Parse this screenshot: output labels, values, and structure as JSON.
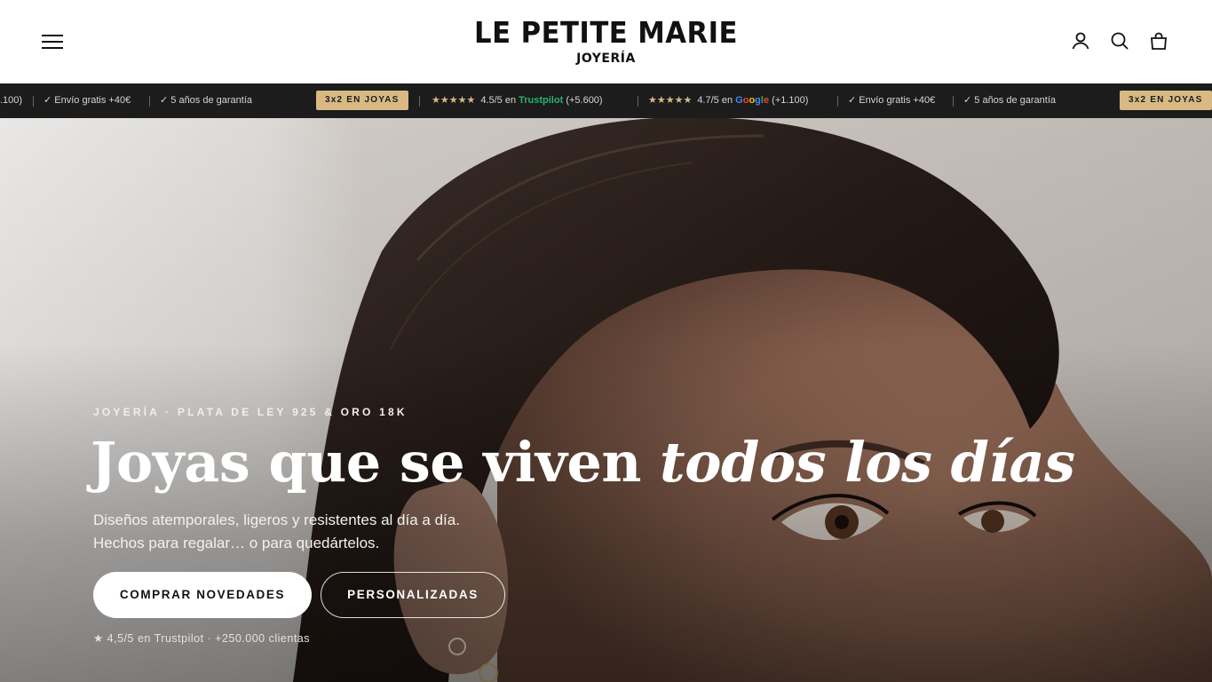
{
  "header": {
    "brand": "LE PETITE MARIE",
    "brand_sub": "JOYERÍA",
    "icons": [
      "menu-icon",
      "account-icon",
      "search-icon",
      "bag-icon"
    ]
  },
  "announcement": {
    "partial_left": ".100)",
    "shipping": "✓ Envío gratis +40€",
    "warranty": "✓ 5 años de garantía",
    "promo": "3x2 EN JOYAS",
    "stars": "★★★★★",
    "trustpilot_score": "4.5/5 en",
    "trustpilot_name": "Trustpilot",
    "trustpilot_count": "(+5.600)",
    "google_score": "4.7/5 en",
    "google_name": [
      "G",
      "o",
      "o",
      "g",
      "l",
      "e"
    ],
    "google_count": "(+1.100)",
    "colors": {
      "background": "#1c1c1c",
      "badge": "#d8b984",
      "trustpilot": "#27b36b"
    }
  },
  "hero": {
    "eyebrow": "JOYERÍA · PLATA DE LEY 925 & ORO 18K",
    "headline_regular": "Joyas que se viven ",
    "headline_italic": "todos los días",
    "subcopy": "Diseños atemporales, ligeros y resistentes al día a día. Hechos para regalar… o para quedártelos.",
    "cta_primary": "COMPRAR NOVEDADES",
    "cta_secondary": "PERSONALIZADAS",
    "rating": "★ 4,5/5 en Trustpilot · +250.000 clientas"
  }
}
